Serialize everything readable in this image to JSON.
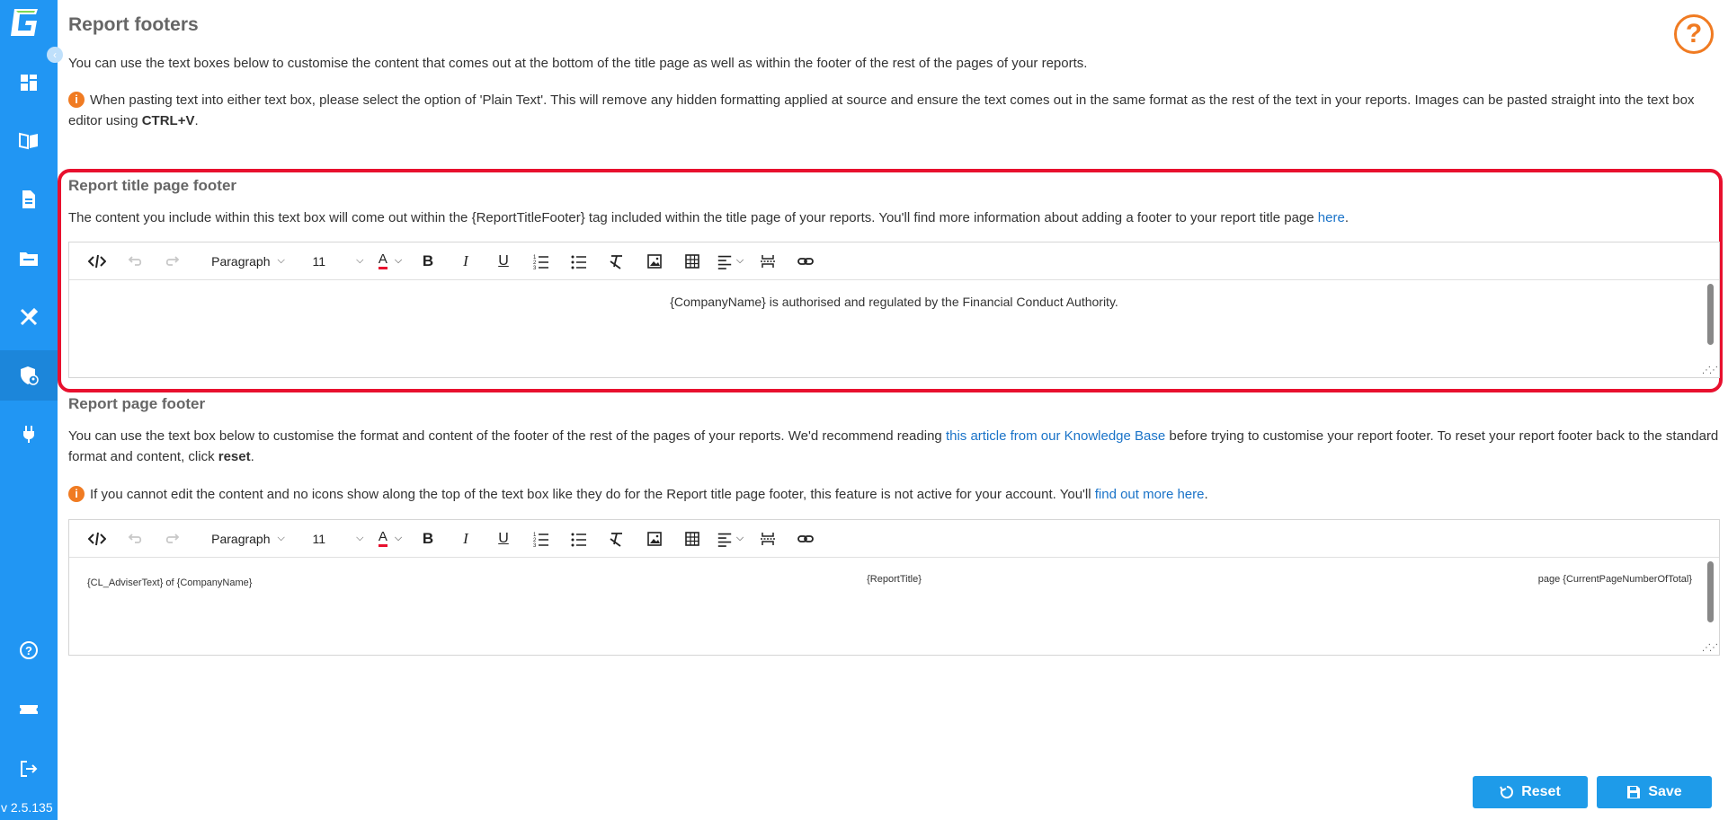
{
  "version": "v 2.5.135",
  "sidebar": {
    "items": [
      {
        "icon": "dashboard-icon"
      },
      {
        "icon": "book-icon"
      },
      {
        "icon": "document-icon"
      },
      {
        "icon": "folder-icon"
      },
      {
        "icon": "tools-icon"
      },
      {
        "icon": "shield-user-icon",
        "active": true
      },
      {
        "icon": "plug-icon"
      },
      {
        "icon": "help-icon"
      },
      {
        "icon": "ticket-icon"
      },
      {
        "icon": "logout-icon"
      }
    ]
  },
  "page": {
    "title": "Report footers",
    "intro": "You can use the text boxes below to customise the content that comes out at the bottom of the title page as well as within the footer of the rest of the pages of your reports.",
    "paste_note_a": "When pasting text into either text box, please select the option of 'Plain Text'. This will remove any hidden formatting applied at source and ensure the text comes out in the same format as the rest of the text in your reports. Images can be pasted straight into the text box editor using ",
    "paste_note_key": "CTRL+V",
    "paste_note_end": "."
  },
  "title_footer": {
    "heading": "Report title page footer",
    "desc": "The content you include within this text box will come out within the {ReportTitleFooter} tag included within the title page of your reports. You'll find more information about adding a footer to your report title page ",
    "link": "here",
    "desc_end": ".",
    "content": "{CompanyName} is authorised and regulated by the Financial Conduct Authority."
  },
  "page_footer": {
    "heading": "Report page footer",
    "desc_a": "You can use the text box below to customise the format and content of the footer of the rest of the pages of your reports. We'd recommend reading ",
    "desc_link": "this article from our Knowledge Base",
    "desc_b": " before trying to customise your report footer. To reset your report footer back to the standard format and content, click ",
    "desc_bold": "reset",
    "desc_end": ".",
    "note_a": "If you cannot edit the content and no icons show along the top of the text box like they do for the Report title page footer, this feature is not active for your account. You'll ",
    "note_link": "find out more here",
    "note_end": ".",
    "left": "{CL_AdviserText} of {CompanyName}",
    "center": "{ReportTitle}",
    "right": "page {CurrentPageNumberOfTotal}"
  },
  "toolbar": {
    "block_format": "Paragraph",
    "font_size": "11"
  },
  "buttons": {
    "reset": "Reset",
    "save": "Save"
  },
  "colors": {
    "sidebar": "#2196f3",
    "accent": "#1e9be9",
    "highlight": "#e8102e",
    "info": "#f07b22"
  }
}
